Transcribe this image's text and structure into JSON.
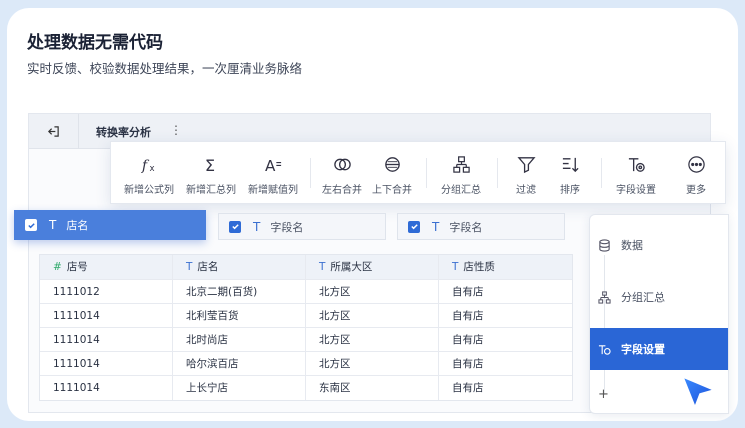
{
  "headline": "处理数据无需代码",
  "subline": "实时反馈、校验数据处理结果，一次厘清业务脉络",
  "app": {
    "tab_title": "转换率分析",
    "tab_more": "⋮"
  },
  "toolbar": [
    {
      "label": "新增公式列",
      "icon": "formula-icon"
    },
    {
      "label": "新增汇总列",
      "icon": "sigma-icon"
    },
    {
      "label": "新增赋值列",
      "icon": "assign-icon"
    },
    {
      "label": "左右合并",
      "icon": "merge-horizontal-icon"
    },
    {
      "label": "上下合并",
      "icon": "merge-vertical-icon"
    },
    {
      "label": "分组汇总",
      "icon": "group-icon"
    },
    {
      "label": "过滤",
      "icon": "filter-icon"
    },
    {
      "label": "排序",
      "icon": "sort-icon"
    },
    {
      "label": "字段设置",
      "icon": "field-settings-icon"
    },
    {
      "label": "更多",
      "icon": "more-icon"
    }
  ],
  "fields": [
    {
      "label": "店名",
      "active": true
    },
    {
      "label": "字段名",
      "active": false
    },
    {
      "label": "字段名",
      "active": false
    }
  ],
  "table": {
    "headers": [
      "店号",
      "店名",
      "所属大区",
      "店性质"
    ],
    "rows": [
      [
        "1111012",
        "北京二期(百货)",
        "北方区",
        "自有店"
      ],
      [
        "1111014",
        "北利莹百货",
        "北方区",
        "自有店"
      ],
      [
        "1111014",
        "北时尚店",
        "北方区",
        "自有店"
      ],
      [
        "1111014",
        "哈尔滨百店",
        "北方区",
        "自有店"
      ],
      [
        "1111014",
        "上长宁店",
        "东南区",
        "自有店"
      ]
    ]
  },
  "side_panel": {
    "items": [
      {
        "label": "数据",
        "icon": "database-icon"
      },
      {
        "label": "分组汇总",
        "icon": "group-icon"
      },
      {
        "label": "字段设置",
        "icon": "field-settings-icon"
      }
    ],
    "add": "+"
  },
  "colors": {
    "accent": "#2a66d6",
    "field_active": "#4a7fdc",
    "background": "#dce9f8"
  }
}
